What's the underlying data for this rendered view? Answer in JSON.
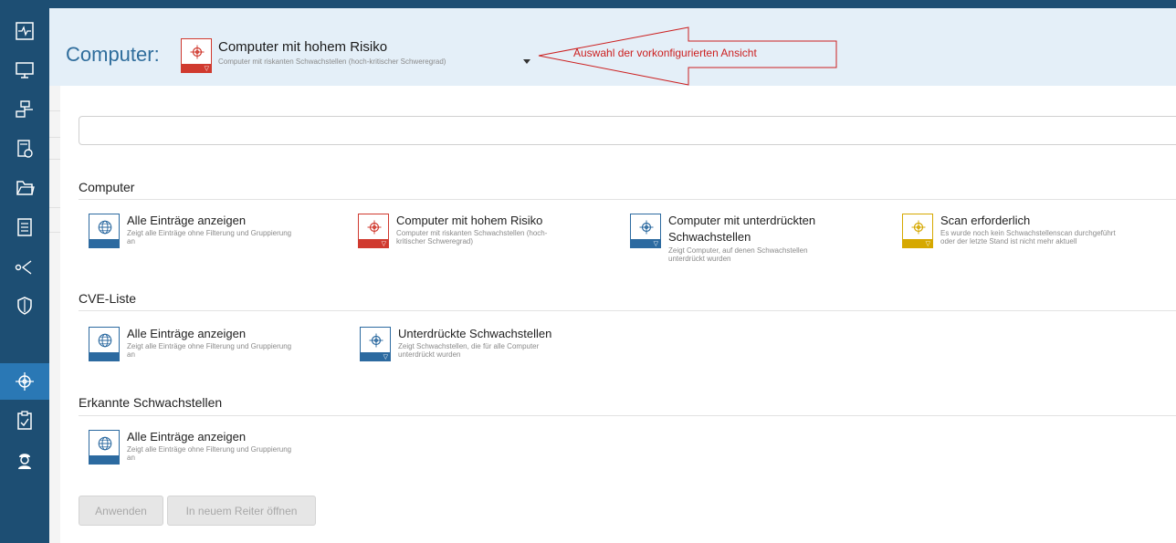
{
  "header": {
    "label": "Computer:",
    "selected_title": "Computer mit hohem Risiko",
    "selected_subtitle": "Computer mit riskanten Schwachstellen (hoch-kritischer Schweregrad)",
    "annotation": "Auswahl der vorkonfigurierten Ansicht"
  },
  "search": {
    "placeholder": "",
    "value": ""
  },
  "sidebar": {
    "items": [
      {
        "icon": "monitor-pulse-icon"
      },
      {
        "icon": "desktop-icon"
      },
      {
        "icon": "network-icon"
      },
      {
        "icon": "package-icon"
      },
      {
        "icon": "folder-icon"
      },
      {
        "icon": "document-icon"
      },
      {
        "icon": "share-icon"
      },
      {
        "icon": "shield-icon"
      },
      {
        "icon": "crosshair-icon",
        "active": true
      },
      {
        "icon": "clipboard-check-icon"
      },
      {
        "icon": "technician-icon"
      }
    ]
  },
  "sections": [
    {
      "title": "Computer",
      "entries": [
        {
          "title": "Alle Einträge anzeigen",
          "desc_lines": [
            "Zeigt alle Einträge ohne Filterung und Gruppierung",
            "an"
          ],
          "icon": "globe-icon",
          "band": "blue",
          "filter": false
        },
        {
          "title": "Computer mit hohem Risiko",
          "desc_lines": [
            "Computer mit riskanten Schwachstellen (hoch-",
            "kritischer Schweregrad)"
          ],
          "icon": "crosshair-icon",
          "band": "red",
          "filter": true
        },
        {
          "title": "Computer mit unterdrückten",
          "title2": "Schwachstellen",
          "desc_lines": [
            "Zeigt Computer, auf denen Schwachstellen",
            "unterdrückt wurden"
          ],
          "icon": "crosshair-icon",
          "band": "blue",
          "filter": true
        },
        {
          "title": "Scan erforderlich",
          "desc_lines": [
            "Es wurde noch kein Schwachstellenscan durchgeführt",
            "oder der letzte Stand ist nicht mehr aktuell"
          ],
          "icon": "crosshair-icon",
          "band": "yellow",
          "filter": true
        }
      ]
    },
    {
      "title": "CVE-Liste",
      "entries": [
        {
          "title": "Alle Einträge anzeigen",
          "desc_lines": [
            "Zeigt alle Einträge ohne Filterung und Gruppierung",
            "an"
          ],
          "icon": "globe-icon",
          "band": "blue",
          "filter": false
        },
        {
          "title": "Unterdrückte Schwachstellen",
          "desc_lines": [
            "Zeigt Schwachstellen, die für alle Computer",
            "unterdrückt wurden"
          ],
          "icon": "crosshair-icon",
          "band": "blue",
          "filter": true
        }
      ]
    },
    {
      "title": "Erkannte Schwachstellen",
      "entries": [
        {
          "title": "Alle Einträge anzeigen",
          "desc_lines": [
            "Zeigt alle Einträge ohne Filterung und Gruppierung",
            "an"
          ],
          "icon": "globe-icon",
          "band": "blue",
          "filter": false
        }
      ]
    }
  ],
  "buttons": {
    "apply": "Anwenden",
    "open_new_tab": "In neuem Reiter öffnen"
  },
  "colors": {
    "sidebar": "#1d4e73",
    "sidebar_active": "#2a78b5",
    "blue": "#2c6aa0",
    "red": "#d03a2f",
    "yellow": "#d6a800",
    "annotation": "#cc1f1f"
  }
}
